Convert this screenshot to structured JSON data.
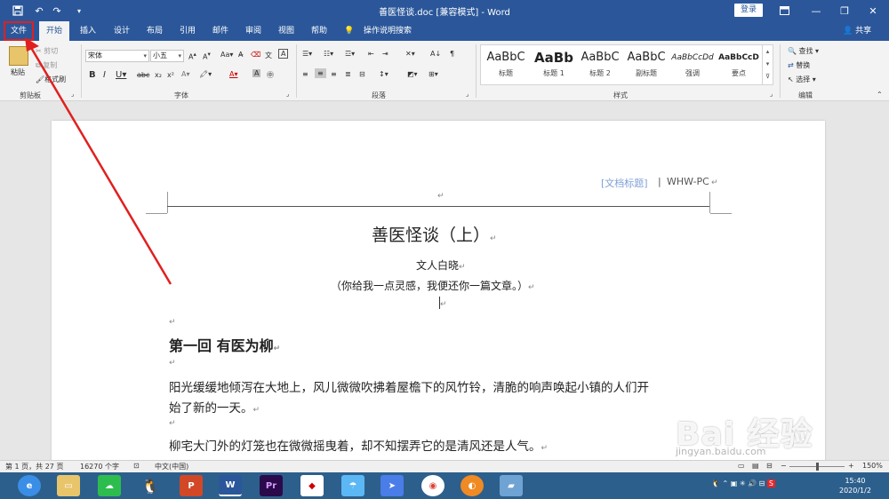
{
  "titlebar": {
    "title": "善医怪谈.doc [兼容模式] - Word",
    "login": "登录",
    "save_icon": "save-icon",
    "undo_icon": "undo-icon",
    "redo_icon": "redo-icon"
  },
  "tabs": [
    {
      "label": "文件"
    },
    {
      "label": "开始"
    },
    {
      "label": "插入"
    },
    {
      "label": "设计"
    },
    {
      "label": "布局"
    },
    {
      "label": "引用"
    },
    {
      "label": "邮件"
    },
    {
      "label": "审阅"
    },
    {
      "label": "视图"
    },
    {
      "label": "帮助"
    },
    {
      "label": "操作说明搜索"
    }
  ],
  "share": "共享",
  "ribbon": {
    "clipboard": {
      "paste": "粘贴",
      "cut": "剪切",
      "copy": "复制",
      "format_painter": "格式刷",
      "label": "剪贴板"
    },
    "font": {
      "font_name": "宋体",
      "font_size": "小五",
      "label": "字体"
    },
    "paragraph": {
      "label": "段落"
    },
    "styles": {
      "label": "样式",
      "items": [
        {
          "preview": "AaBbC",
          "name": "标题"
        },
        {
          "preview": "AaBb",
          "name": "标题 1"
        },
        {
          "preview": "AaBbC",
          "name": "标题 2"
        },
        {
          "preview": "AaBbC",
          "name": "副标题"
        },
        {
          "preview": "AaBbCcDd",
          "name": "强调"
        },
        {
          "preview": "AaBbCcD",
          "name": "要点"
        }
      ]
    },
    "editing": {
      "find": "查找",
      "replace": "替换",
      "select": "选择",
      "label": "编辑"
    }
  },
  "document": {
    "header_title": "[文档标题]",
    "header_sep": "|",
    "header_pc": "WHW-PC",
    "title": "善医怪谈（上）",
    "author": "文人白晓",
    "subtitle": "（你给我一点灵感，我便还你一篇文章。）",
    "chapter": "第一回  有医为柳",
    "para1_line1": "阳光缓缓地倾泻在大地上，风儿微微吹拂着屋檐下的风竹铃，清脆的响声唤起小镇的人们开",
    "para1_line2": "始了新的一天。",
    "para2": "柳宅大门外的灯笼也在微微摇曳着，却不知摆弄它的是清风还是人气。",
    "para_mark": "↵"
  },
  "statusbar": {
    "page": "第 1 页，共 27 页",
    "words": "16270 个字",
    "language": "中文(中国)",
    "zoom": "150%"
  },
  "taskbar": {
    "time": "15:40",
    "date": "2020/1/2"
  },
  "watermark": {
    "brand": "Bai 经验",
    "url": "jingyan.baidu.com"
  },
  "colors": {
    "word_blue": "#2b579a",
    "annotation_red": "#e02020"
  }
}
